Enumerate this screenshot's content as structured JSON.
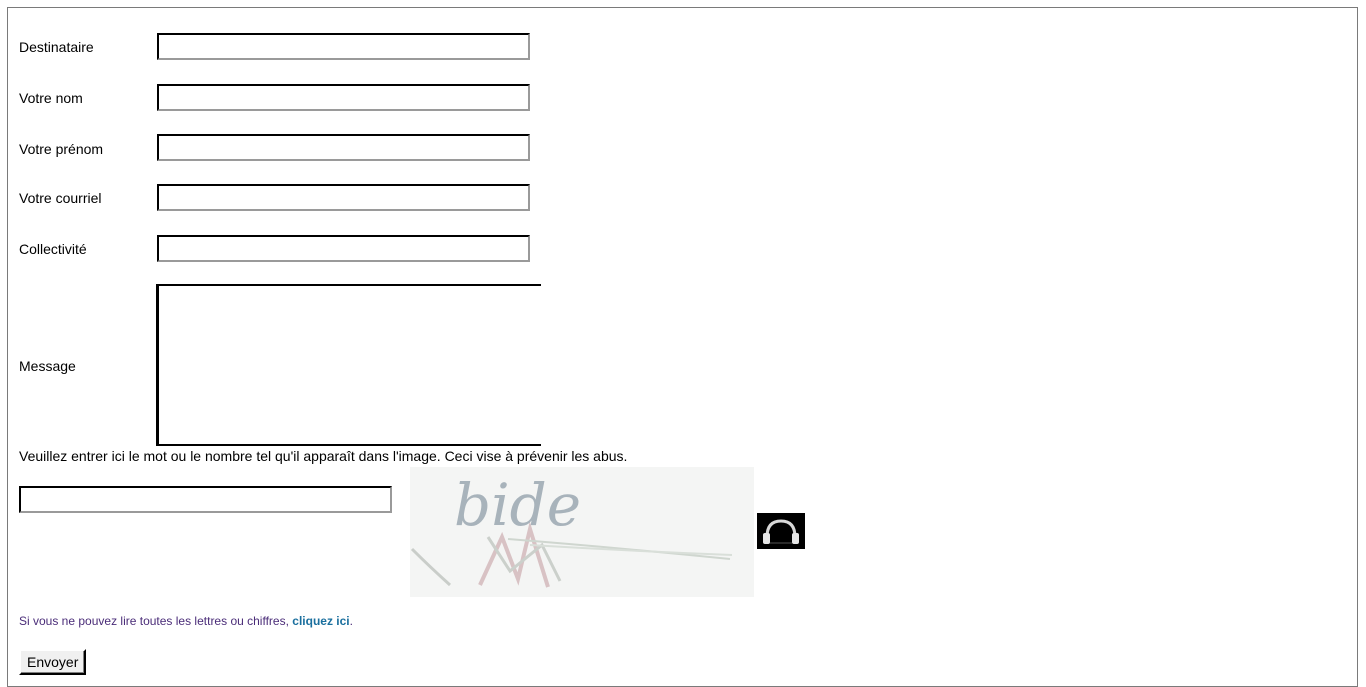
{
  "form": {
    "fields": [
      {
        "label": "Destinataire",
        "value": ""
      },
      {
        "label": "Votre nom",
        "value": ""
      },
      {
        "label": "Votre prénom",
        "value": ""
      },
      {
        "label": "Votre courriel",
        "value": ""
      },
      {
        "label": "Collectivité",
        "value": ""
      }
    ],
    "message_label": "Message",
    "message_value": ""
  },
  "captcha": {
    "instruction": "Veuillez entrer ici le mot ou le nombre tel qu'il apparaît dans l'image. Ceci vise à prévenir les abus.",
    "value": "",
    "image_text": "bide",
    "audio_icon": "headphones-icon",
    "hint_prefix": "Si vous ne pouvez lire toutes les lettres ou chiffres, ",
    "hint_link": "cliquez ici",
    "hint_suffix": "."
  },
  "submit_label": "Envoyer",
  "colors": {
    "hint_text": "#4a2c78",
    "hint_link": "#1a6f9e"
  }
}
